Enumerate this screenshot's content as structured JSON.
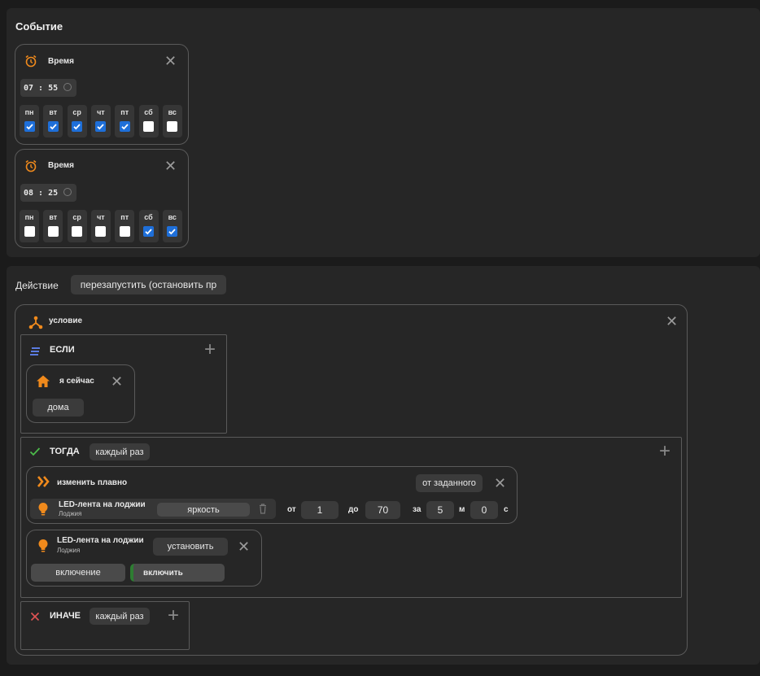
{
  "event": {
    "title": "Событие",
    "triggers": [
      {
        "label": "Время",
        "time": "07 : 55",
        "days": [
          {
            "label": "пн",
            "checked": true
          },
          {
            "label": "вт",
            "checked": true
          },
          {
            "label": "ср",
            "checked": true
          },
          {
            "label": "чт",
            "checked": true
          },
          {
            "label": "пт",
            "checked": true
          },
          {
            "label": "сб",
            "checked": false
          },
          {
            "label": "вс",
            "checked": false
          }
        ]
      },
      {
        "label": "Время",
        "time": "08 : 25",
        "days": [
          {
            "label": "пн",
            "checked": false
          },
          {
            "label": "вт",
            "checked": false
          },
          {
            "label": "ср",
            "checked": false
          },
          {
            "label": "чт",
            "checked": false
          },
          {
            "label": "пт",
            "checked": false
          },
          {
            "label": "сб",
            "checked": true
          },
          {
            "label": "вс",
            "checked": true
          }
        ]
      }
    ]
  },
  "action": {
    "title": "Действие",
    "mode": "перезапустить (остановить пр",
    "condition": {
      "label": "условие",
      "if": {
        "label": "ЕСЛИ",
        "presence": {
          "label": "я сейчас",
          "value": "дома"
        }
      },
      "then": {
        "label": "ТОГДА",
        "frequency": "каждый раз",
        "smooth": {
          "label": "изменить плавно",
          "from_mode": "от заданного",
          "device_name": "LED-лента на лоджии",
          "device_room": "Лоджия",
          "property": "яркость",
          "from_label": "от",
          "from_value": "1",
          "to_label": "до",
          "to_value": "70",
          "in_label": "за",
          "minutes": "5",
          "minutes_label": "м",
          "seconds": "0",
          "seconds_label": "с"
        },
        "set": {
          "device_name": "LED-лента на лоджии",
          "device_room": "Лоджия",
          "action": "установить",
          "property": "включение",
          "value": "включить"
        }
      },
      "else": {
        "label": "ИНАЧЕ",
        "frequency": "каждый раз"
      }
    }
  },
  "colors": {
    "accent_orange": "#f08a1c",
    "check_blue": "#1e6fd9",
    "then_green": "#4cbb4a",
    "else_red": "#e05454",
    "if_blue": "#5b7be0"
  }
}
